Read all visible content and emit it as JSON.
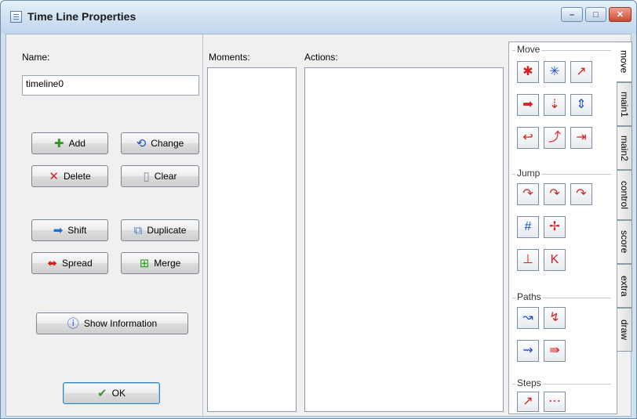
{
  "window": {
    "title": "Time Line Properties",
    "minimize": "–",
    "maximize": "□",
    "close": "✕"
  },
  "name": {
    "label": "Name:",
    "value": "timeline0"
  },
  "buttons": {
    "add": "Add",
    "change": "Change",
    "delete": "Delete",
    "clear": "Clear",
    "shift": "Shift",
    "duplicate": "Duplicate",
    "spread": "Spread",
    "merge": "Merge",
    "show_information": "Show Information",
    "ok": "OK"
  },
  "moments": {
    "label": "Moments:"
  },
  "actions": {
    "label": "Actions:"
  },
  "groups": {
    "move": "Move",
    "jump": "Jump",
    "paths": "Paths",
    "steps": "Steps"
  },
  "tabs": [
    "move",
    "main1",
    "main2",
    "control",
    "score",
    "extra",
    "draw"
  ],
  "colors": {
    "titlebar": "#cfe1f2",
    "red_icon": "#d62020",
    "blue_icon": "#1d4fc4",
    "ok_check": "#3a9a2a"
  }
}
